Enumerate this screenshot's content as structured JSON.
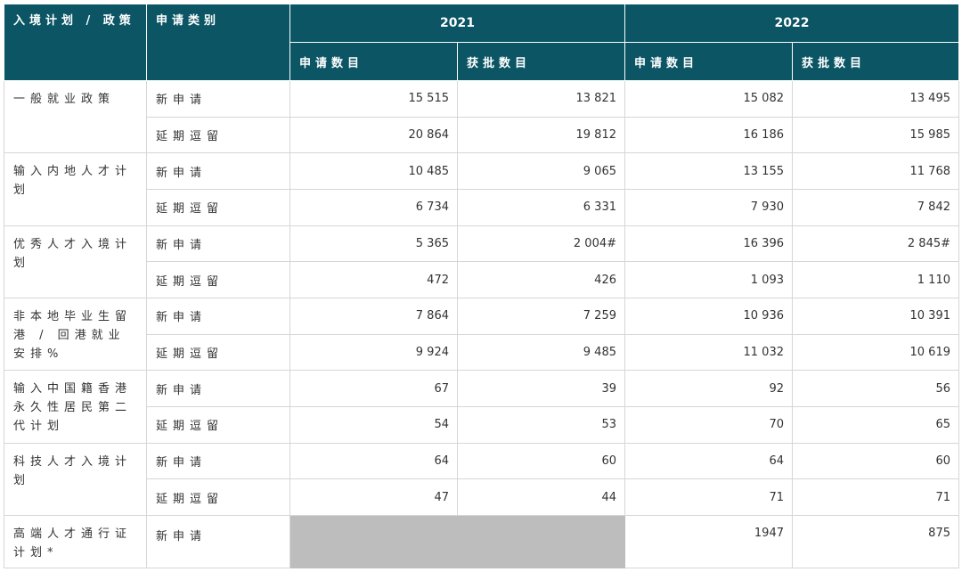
{
  "header": {
    "policy_col": "入境计划 / 政策",
    "type_col": "申请类别",
    "year_a": "2021",
    "year_b": "2022",
    "applications": "申请数目",
    "approved": "获批数目"
  },
  "kinds": {
    "new": "新申请",
    "extension": "延期逗留"
  },
  "rows": [
    {
      "policy": "一般就业政策",
      "new": [
        "15 515",
        "13 821",
        "15 082",
        "13 495"
      ],
      "extension": [
        "20 864",
        "19 812",
        "16 186",
        "15 985"
      ]
    },
    {
      "policy": "输入内地人才计划",
      "new": [
        "10 485",
        "9 065",
        "13 155",
        "11 768"
      ],
      "extension": [
        "6 734",
        "6 331",
        "7 930",
        "7 842"
      ]
    },
    {
      "policy": "优秀人才入境计划",
      "new": [
        "5 365",
        "2 004#",
        "16 396",
        "2 845#"
      ],
      "extension": [
        "472",
        "426",
        "1 093",
        "1 110"
      ]
    },
    {
      "policy": "非本地毕业生留港 / 回港就业安排%",
      "new": [
        "7 864",
        "7 259",
        "10 936",
        "10 391"
      ],
      "extension": [
        "9 924",
        "9 485",
        "11 032",
        "10 619"
      ]
    },
    {
      "policy": "输入中国籍香港永久性居民第二代计划",
      "new": [
        "67",
        "39",
        "92",
        "56"
      ],
      "extension": [
        "54",
        "53",
        "70",
        "65"
      ]
    },
    {
      "policy": "科技人才入境计划",
      "new": [
        "64",
        "60",
        "64",
        "60"
      ],
      "extension": [
        "47",
        "44",
        "71",
        "71"
      ]
    }
  ],
  "last_row": {
    "policy": "高端人才通行证计划*",
    "new_2022": [
      "1947",
      "875"
    ]
  }
}
